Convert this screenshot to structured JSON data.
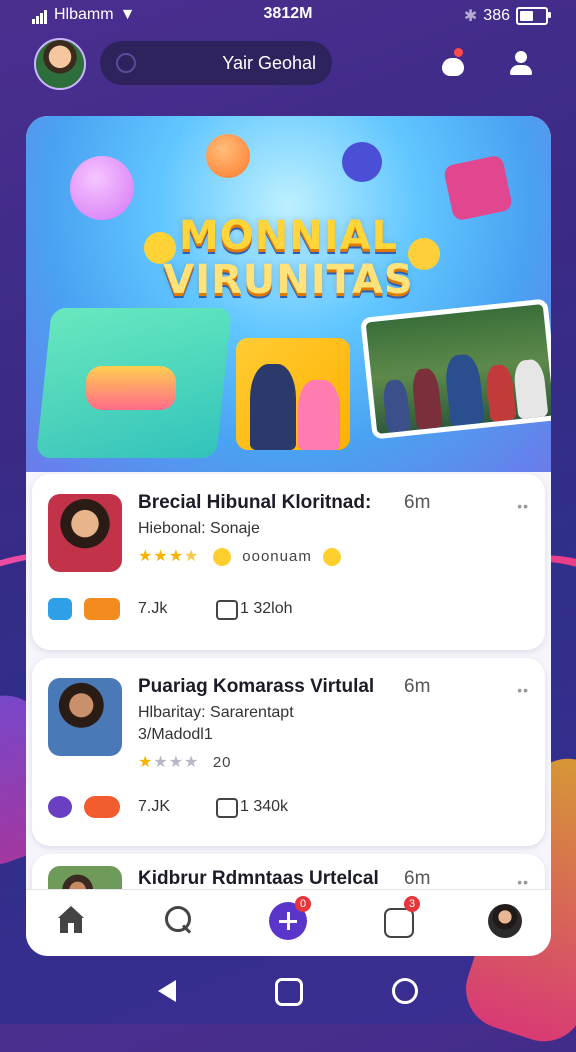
{
  "status_bar": {
    "carrier": "Hlbamm",
    "time": "3812M",
    "battery_text": "386"
  },
  "header": {
    "search_text": "Yair Geohal"
  },
  "hero": {
    "title_line1": "MONNIAL",
    "title_line2": "VIRUNITAS"
  },
  "feed": [
    {
      "title": "Brecial Hibunal Kloritnad:",
      "time": "6m",
      "subtitle": "Hiebonal: Sonaje",
      "subtitle2": "",
      "rating": 4,
      "rating_text": "",
      "extra_label": "ooonuam",
      "stat1": "7.Jk",
      "stat2": "1 32loh"
    },
    {
      "title": "Puariag Komarass Virtulal",
      "time": "6m",
      "subtitle": "Hlbaritay: Sararentapt",
      "subtitle2": "3/Madodl1",
      "rating": 1,
      "rating_text": "20",
      "extra_label": "",
      "stat1": "7.JK",
      "stat2": "1 340k"
    },
    {
      "title": "Kidbrur Rdmntaas Urtelcal",
      "time": "6m"
    }
  ],
  "bottom_nav": {
    "create_badge": "0",
    "messages_badge": "3"
  }
}
